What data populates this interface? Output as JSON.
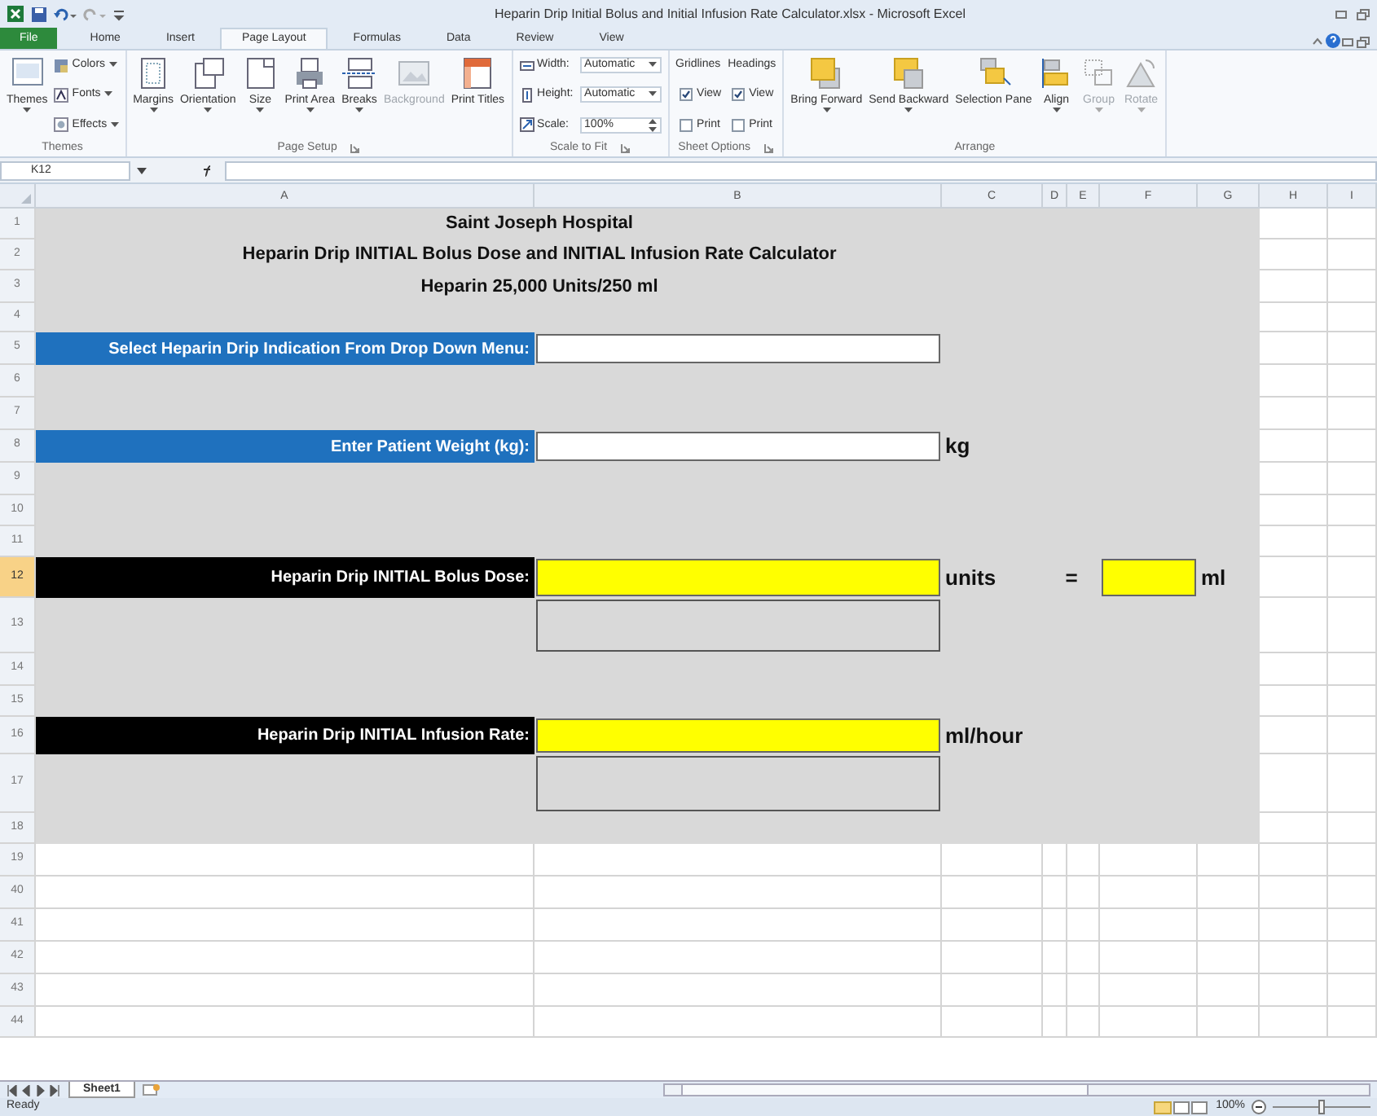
{
  "window": {
    "title": "Heparin Drip Initial Bolus and Initial Infusion Rate Calculator.xlsx - Microsoft Excel"
  },
  "tabs": [
    {
      "label": "File",
      "selected": false,
      "kind": "file"
    },
    {
      "label": "Home",
      "selected": false,
      "kind": "tab"
    },
    {
      "label": "Insert",
      "selected": false,
      "kind": "tab"
    },
    {
      "label": "Page Layout",
      "selected": true,
      "kind": "tab"
    },
    {
      "label": "Formulas",
      "selected": false,
      "kind": "tab"
    },
    {
      "label": "Data",
      "selected": false,
      "kind": "tab"
    },
    {
      "label": "Review",
      "selected": false,
      "kind": "tab"
    },
    {
      "label": "View",
      "selected": false,
      "kind": "tab"
    }
  ],
  "ribbon": {
    "groups": [
      {
        "label": "Themes",
        "launcher": false,
        "items": [
          {
            "kind": "large",
            "label": "Themes",
            "dropdown": true,
            "disabled": false
          },
          {
            "kind": "small",
            "label": "Colors",
            "dropdown": true,
            "disabled": false
          },
          {
            "kind": "small",
            "label": "Fonts",
            "dropdown": true,
            "disabled": false
          },
          {
            "kind": "small",
            "label": "Effects",
            "dropdown": true,
            "disabled": false
          }
        ]
      },
      {
        "label": "Page Setup",
        "launcher": true,
        "items": [
          {
            "kind": "large",
            "label": "Margins",
            "dropdown": true,
            "disabled": false
          },
          {
            "kind": "large",
            "label": "Orientation",
            "dropdown": true,
            "disabled": false
          },
          {
            "kind": "large",
            "label": "Size",
            "dropdown": true,
            "disabled": false
          },
          {
            "kind": "large",
            "label": "Print Area",
            "dropdown": true,
            "disabled": false
          },
          {
            "kind": "large",
            "label": "Breaks",
            "dropdown": true,
            "disabled": false
          },
          {
            "kind": "large",
            "label": "Background",
            "dropdown": false,
            "disabled": true
          },
          {
            "kind": "large",
            "label": "Print Titles",
            "dropdown": false,
            "disabled": false
          }
        ]
      },
      {
        "label": "Scale to Fit",
        "launcher": true,
        "items": [
          {
            "kind": "dropdown",
            "label": "Width:",
            "value": "Automatic"
          },
          {
            "kind": "dropdown",
            "label": "Height:",
            "value": "Automatic"
          },
          {
            "kind": "spinner",
            "label": "Scale:",
            "value": "100%"
          }
        ]
      },
      {
        "label": "Sheet Options",
        "launcher": true,
        "items": [
          {
            "kind": "heading",
            "label": "Gridlines"
          },
          {
            "kind": "check",
            "label": "View",
            "checked": true
          },
          {
            "kind": "check",
            "label": "Print",
            "checked": false
          },
          {
            "kind": "heading",
            "label": "Headings"
          },
          {
            "kind": "check",
            "label": "View",
            "checked": true
          },
          {
            "kind": "check",
            "label": "Print",
            "checked": false
          }
        ]
      },
      {
        "label": "Arrange",
        "launcher": false,
        "items": [
          {
            "kind": "large",
            "label": "Bring Forward",
            "dropdown": true,
            "disabled": false
          },
          {
            "kind": "large",
            "label": "Send Backward",
            "dropdown": true,
            "disabled": false
          },
          {
            "kind": "large",
            "label": "Selection Pane",
            "dropdown": false,
            "disabled": false
          },
          {
            "kind": "large",
            "label": "Align",
            "dropdown": true,
            "disabled": false
          },
          {
            "kind": "large",
            "label": "Group",
            "dropdown": true,
            "disabled": true
          },
          {
            "kind": "large",
            "label": "Rotate",
            "dropdown": true,
            "disabled": true
          }
        ]
      }
    ]
  },
  "formula_bar": {
    "name_box": "K12"
  },
  "sheet": {
    "columns": [
      "A",
      "B",
      "C",
      "D",
      "E",
      "F",
      "G",
      "H",
      "I"
    ],
    "rows": [
      {
        "number": "1",
        "selected": false,
        "shaded": true,
        "cells": [
          {
            "kind": "title",
            "text": "Saint Joseph Hospital"
          },
          {
            "kind": "merged"
          },
          {
            "kind": "merged"
          }
        ]
      },
      {
        "number": "2",
        "selected": false,
        "shaded": true,
        "cells": [
          {
            "kind": "title",
            "text": "Heparin Drip INITIAL Bolus Dose and INITIAL Infusion Rate Calculator"
          },
          {
            "kind": "merged"
          },
          {
            "kind": "merged"
          }
        ]
      },
      {
        "number": "3",
        "selected": false,
        "shaded": true,
        "cells": [
          {
            "kind": "title",
            "text": "Heparin 25,000 Units/250 ml"
          },
          {
            "kind": "merged"
          },
          {
            "kind": "merged"
          }
        ]
      },
      {
        "number": "4",
        "selected": false,
        "shaded": true,
        "cells": []
      },
      {
        "number": "5",
        "selected": false,
        "shaded": true,
        "cells": [
          {
            "kind": "label",
            "color": "#1f71be",
            "text": "Select Heparin Drip Indication From Drop Down Menu:"
          },
          {
            "kind": "input"
          }
        ]
      },
      {
        "number": "6",
        "selected": false,
        "shaded": true,
        "cells": []
      },
      {
        "number": "7",
        "selected": false,
        "shaded": true,
        "cells": []
      },
      {
        "number": "8",
        "selected": false,
        "shaded": true,
        "cells": [
          {
            "kind": "label",
            "color": "#1f71be",
            "text": "Enter Patient Weight (kg):"
          },
          {
            "kind": "input"
          },
          {
            "kind": "unit",
            "text": "kg"
          }
        ]
      },
      {
        "number": "9",
        "selected": false,
        "shaded": true,
        "cells": []
      },
      {
        "number": "10",
        "selected": false,
        "shaded": true,
        "cells": []
      },
      {
        "number": "11",
        "selected": false,
        "shaded": true,
        "cells": []
      },
      {
        "number": "12",
        "selected": true,
        "shaded": true,
        "cells": [
          {
            "kind": "label",
            "color": "#000000",
            "text": "Heparin Drip INITIAL Bolus Dose:"
          },
          {
            "kind": "output"
          },
          {
            "kind": "unit",
            "text": "units"
          },
          {
            "kind": "symbol",
            "text": "="
          },
          {
            "kind": "merged"
          },
          {
            "kind": "output"
          },
          {
            "kind": "unit",
            "text": "ml"
          }
        ]
      },
      {
        "number": "13",
        "selected": false,
        "shaded": true,
        "cells": [
          {
            "kind": "blank"
          },
          {
            "kind": "box"
          }
        ]
      },
      {
        "number": "14",
        "selected": false,
        "shaded": true,
        "cells": []
      },
      {
        "number": "15",
        "selected": false,
        "shaded": true,
        "cells": []
      },
      {
        "number": "16",
        "selected": false,
        "shaded": true,
        "cells": [
          {
            "kind": "label",
            "color": "#000000",
            "text": "Heparin Drip INITIAL Infusion Rate:"
          },
          {
            "kind": "output"
          },
          {
            "kind": "unit",
            "text": "ml/hour"
          },
          {
            "kind": "merged"
          },
          {
            "kind": "merged"
          }
        ]
      },
      {
        "number": "17",
        "selected": false,
        "shaded": true,
        "cells": [
          {
            "kind": "blank"
          },
          {
            "kind": "box"
          }
        ]
      },
      {
        "number": "18",
        "selected": false,
        "shaded": true,
        "cells": []
      },
      {
        "number": "19",
        "selected": false,
        "shaded": false,
        "cells": []
      },
      {
        "number": "40",
        "selected": false,
        "shaded": false,
        "cells": []
      },
      {
        "number": "41",
        "selected": false,
        "shaded": false,
        "cells": []
      },
      {
        "number": "42",
        "selected": false,
        "shaded": false,
        "cells": []
      },
      {
        "number": "43",
        "selected": false,
        "shaded": false,
        "cells": []
      },
      {
        "number": "44",
        "selected": false,
        "shaded": false,
        "cells": []
      }
    ]
  },
  "sheet_tabs": [
    {
      "label": "Sheet1",
      "selected": true
    }
  ],
  "status_bar": {
    "text": "Ready",
    "zoom": "100%",
    "zoom_slider": {
      "level": 0.5
    }
  }
}
